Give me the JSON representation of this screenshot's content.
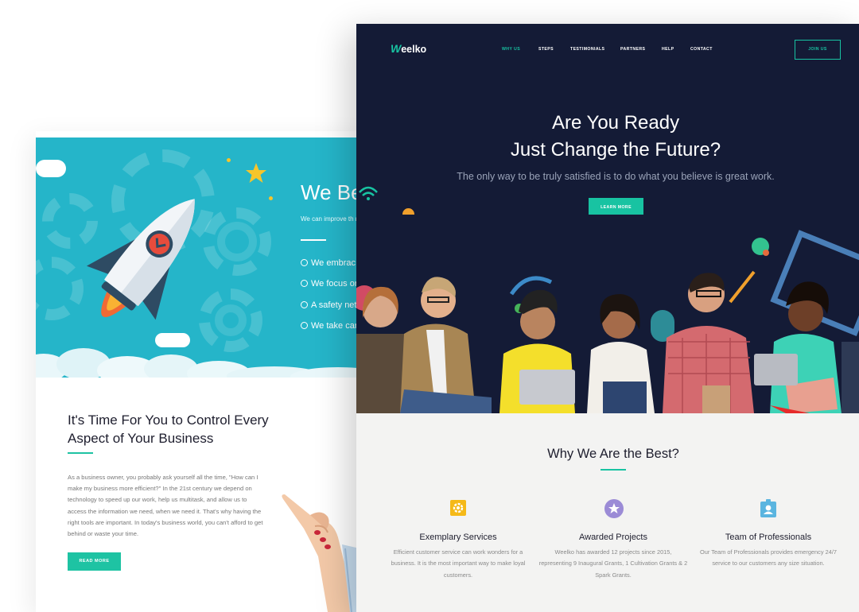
{
  "back_page": {
    "hero_title": "We Be",
    "hero_subtext": "We can improve th net through insurar",
    "features": [
      {
        "icon": "user-circle-icon",
        "label": "We embrac"
      },
      {
        "icon": "crosshair-icon",
        "label": "We focus or"
      },
      {
        "icon": "info-icon",
        "label": "A safety net"
      },
      {
        "icon": "smile-icon",
        "label": "We take car"
      }
    ],
    "heading": "It's Time For You to Control Every Aspect of Your Business",
    "paragraph": "As a business owner, you probably ask yourself all the time, \"How can I make my business more efficient?\" In the 21st century we depend on technology to speed up our work, help us multitask, and allow us to access the information we need, when we need it. That's why having the right tools are important. In today's business world, you can't afford to get behind or waste your time.",
    "read_more": "READ MORE"
  },
  "front_page": {
    "logo": {
      "mark": "W",
      "text": "eelko"
    },
    "nav": [
      {
        "label": "WHY US",
        "active": true
      },
      {
        "label": "STEPS",
        "active": false
      },
      {
        "label": "TESTIMONIALS",
        "active": false
      },
      {
        "label": "PARTNERS",
        "active": false
      },
      {
        "label": "HELP",
        "active": false
      },
      {
        "label": "CONTACT",
        "active": false
      }
    ],
    "join_button": "JOIN US",
    "hero": {
      "title_line1": "Are You Ready",
      "title_line2": "Just Change the Future?",
      "subtitle": "The only way to be truly satisfied is to do what you believe is great work.",
      "button": "LEARN MORE"
    },
    "section": {
      "title": "Why We Are the Best?",
      "features": [
        {
          "icon": "gear-icon",
          "title": "Exemplary Services",
          "text": "Efficient customer service can work wonders for a business. It is the most important way to make loyal customers."
        },
        {
          "icon": "star-icon",
          "title": "Awarded Projects",
          "text": "Weelko has awarded 12 projects since 2015, representing 9 Inaugural Grants, 1 Cultivation Grants & 2 Spark Grants."
        },
        {
          "icon": "id-badge-icon",
          "title": "Team of Professionals",
          "text": "Our Team of Professionals provides emergency 24/7 service to our customers any size situation."
        }
      ]
    }
  },
  "colors": {
    "accent": "#18c3a2",
    "hero_dark": "#141b36",
    "teal_hero": "#25b5c9",
    "gear_yellow": "#f5b918",
    "star_purple": "#9b8bd6",
    "badge_blue": "#5bb5e0"
  }
}
